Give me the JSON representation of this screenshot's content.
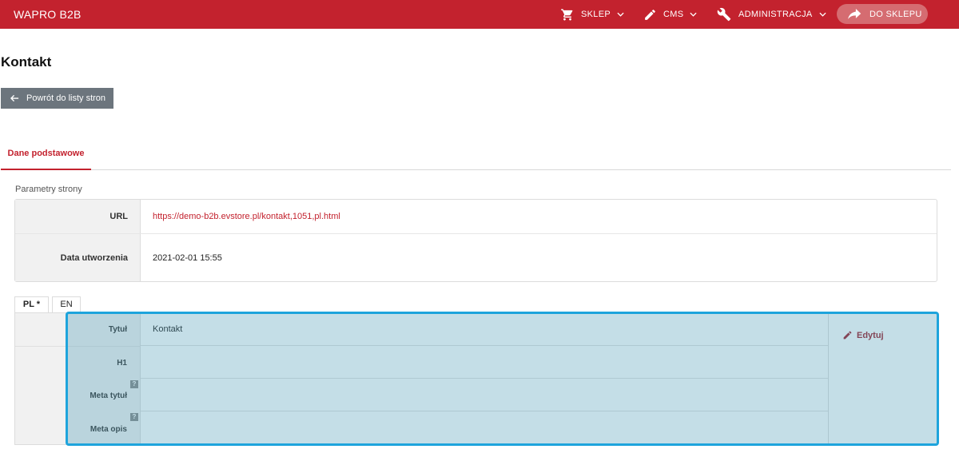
{
  "header": {
    "brand": "WAPRO B2B",
    "nav": [
      {
        "label": "SKLEP",
        "icon": "cart-icon"
      },
      {
        "label": "CMS",
        "icon": "pencil-icon"
      },
      {
        "label": "ADMINISTRACJA",
        "icon": "wrench-icon"
      }
    ],
    "shop_button": {
      "label": "DO SKLEPU",
      "icon": "share-arrow-icon"
    }
  },
  "page": {
    "title": "Kontakt",
    "back_button": "Powrót do listy stron"
  },
  "tabs": [
    {
      "label": "Dane podstawowe",
      "active": true
    }
  ],
  "params": {
    "section_label": "Parametry strony",
    "rows": [
      {
        "label": "URL",
        "value": "https://demo-b2b.evstore.pl/kontakt,1051,pl.html"
      },
      {
        "label": "Data utworzenia",
        "value": "2021-02-01 15:55"
      }
    ]
  },
  "languages": [
    {
      "label": "PL *",
      "active": true
    },
    {
      "label": "EN",
      "active": false
    }
  ],
  "translation": {
    "fields": [
      {
        "label": "Tytuł",
        "value": "Kontakt",
        "help": ""
      },
      {
        "label": "H1",
        "value": "",
        "help": ""
      },
      {
        "label": "Meta tytuł",
        "value": "",
        "help": "?"
      },
      {
        "label": "Meta opis",
        "value": "",
        "help": "?"
      }
    ],
    "edit_label": "Edytuj"
  },
  "colors": {
    "brand": "#c3222e",
    "highlight": "#1ea4dc",
    "button_gray": "#6c757d"
  }
}
